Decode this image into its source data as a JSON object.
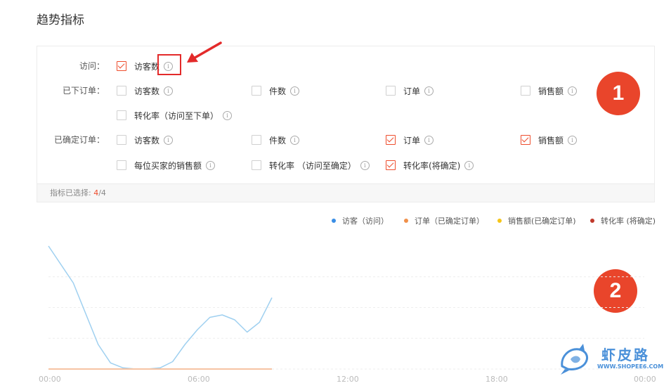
{
  "section_title": "趋势指标",
  "rows": [
    {
      "label": "访问：",
      "options": [
        {
          "label": "访客数",
          "checked": true
        }
      ]
    },
    {
      "label": "已下订单：",
      "options": [
        {
          "label": "访客数",
          "checked": false
        },
        {
          "label": "件数",
          "checked": false
        },
        {
          "label": "订单",
          "checked": false
        },
        {
          "label": "销售额",
          "checked": false
        },
        {
          "label": "转化率（访问至下单）",
          "checked": false
        }
      ]
    },
    {
      "label": "已确定订单：",
      "options": [
        {
          "label": "访客数",
          "checked": false
        },
        {
          "label": "件数",
          "checked": false
        },
        {
          "label": "订单",
          "checked": true
        },
        {
          "label": "销售额",
          "checked": true
        },
        {
          "label": "每位买家的销售额",
          "checked": false
        },
        {
          "label": "转化率 （访问至确定）",
          "checked": false
        },
        {
          "label": "转化率(将确定)",
          "checked": true
        }
      ]
    }
  ],
  "footer": {
    "label": "指标已选择:",
    "selected": "4",
    "total": "/4"
  },
  "badges": {
    "one": "1",
    "two": "2"
  },
  "info_glyph": "i",
  "colors": {
    "accent": "#ee4d2d",
    "badge": "#e9452b"
  },
  "chart_data": {
    "type": "line",
    "x_ticks": [
      "00:00",
      "06:00",
      "12:00",
      "18:00",
      "00:00"
    ],
    "legend": [
      {
        "name": "访客（访问）",
        "color": "#3a8ee6"
      },
      {
        "name": "订单（已确定订单）",
        "color": "#f0904a"
      },
      {
        "name": "销售额(已确定订单)",
        "color": "#f5c518"
      },
      {
        "name": "转化率 (将确定)",
        "color": "#c0392b"
      }
    ],
    "x_range_hours": [
      0,
      24
    ],
    "grid": true,
    "series": [
      {
        "name": "访客（访问）",
        "color": "#9fd0f0",
        "x": [
          0,
          1,
          2,
          2.5,
          3,
          3.5,
          4,
          4.5,
          5,
          5.5,
          6,
          6.5,
          7,
          7.5,
          8,
          8.5,
          9
        ],
        "y": [
          100,
          70,
          20,
          5,
          1,
          0,
          0,
          1,
          6,
          20,
          32,
          42,
          44,
          40,
          30,
          38,
          58
        ]
      },
      {
        "name": "订单（已确定订单）",
        "color": "#f6c3a3",
        "x": [
          0,
          9
        ],
        "y": [
          0,
          0
        ]
      }
    ]
  },
  "watermark": {
    "title": "虾皮路",
    "url": "WWW.SHOPEE6.COM"
  }
}
